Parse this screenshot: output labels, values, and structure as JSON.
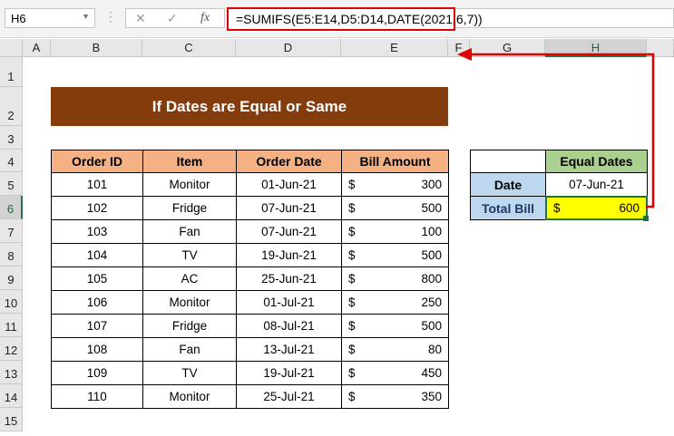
{
  "formula_bar": {
    "name_box": "H6",
    "cancel_icon": "✕",
    "enter_icon": "✓",
    "fx_label": "fx",
    "formula": "=SUMIFS(E5:E14,D5:D14,DATE(2021,6,7))"
  },
  "columns": [
    "A",
    "B",
    "C",
    "D",
    "E",
    "F",
    "G",
    "H"
  ],
  "rows": [
    "1",
    "2",
    "3",
    "4",
    "5",
    "6",
    "7",
    "8",
    "9",
    "10",
    "11",
    "12",
    "13",
    "14",
    "15"
  ],
  "title": "If Dates are Equal or Same",
  "table": {
    "headers": [
      "Order ID",
      "Item",
      "Order Date",
      "Bill Amount"
    ],
    "currency": "$",
    "rows": [
      [
        "101",
        "Monitor",
        "01-Jun-21",
        "300"
      ],
      [
        "102",
        "Fridge",
        "07-Jun-21",
        "500"
      ],
      [
        "103",
        "Fan",
        "07-Jun-21",
        "100"
      ],
      [
        "104",
        "TV",
        "19-Jun-21",
        "500"
      ],
      [
        "105",
        "AC",
        "25-Jun-21",
        "800"
      ],
      [
        "106",
        "Monitor",
        "01-Jul-21",
        "250"
      ],
      [
        "107",
        "Fridge",
        "08-Jul-21",
        "500"
      ],
      [
        "108",
        "Fan",
        "13-Jul-21",
        "80"
      ],
      [
        "109",
        "TV",
        "19-Jul-21",
        "450"
      ],
      [
        "110",
        "Monitor",
        "25-Jul-21",
        "350"
      ]
    ]
  },
  "result": {
    "header": "Equal Dates",
    "date_label": "Date",
    "date_value": "07-Jun-21",
    "total_label": "Total Bill",
    "currency": "$",
    "total_value": "600"
  },
  "colors": {
    "title_bg": "#843c0c",
    "header_bg": "#f4b183",
    "result_header_bg": "#a9d08e",
    "label_bg": "#bdd7ee",
    "highlight": "#ffff00",
    "arrow": "#e00000"
  }
}
